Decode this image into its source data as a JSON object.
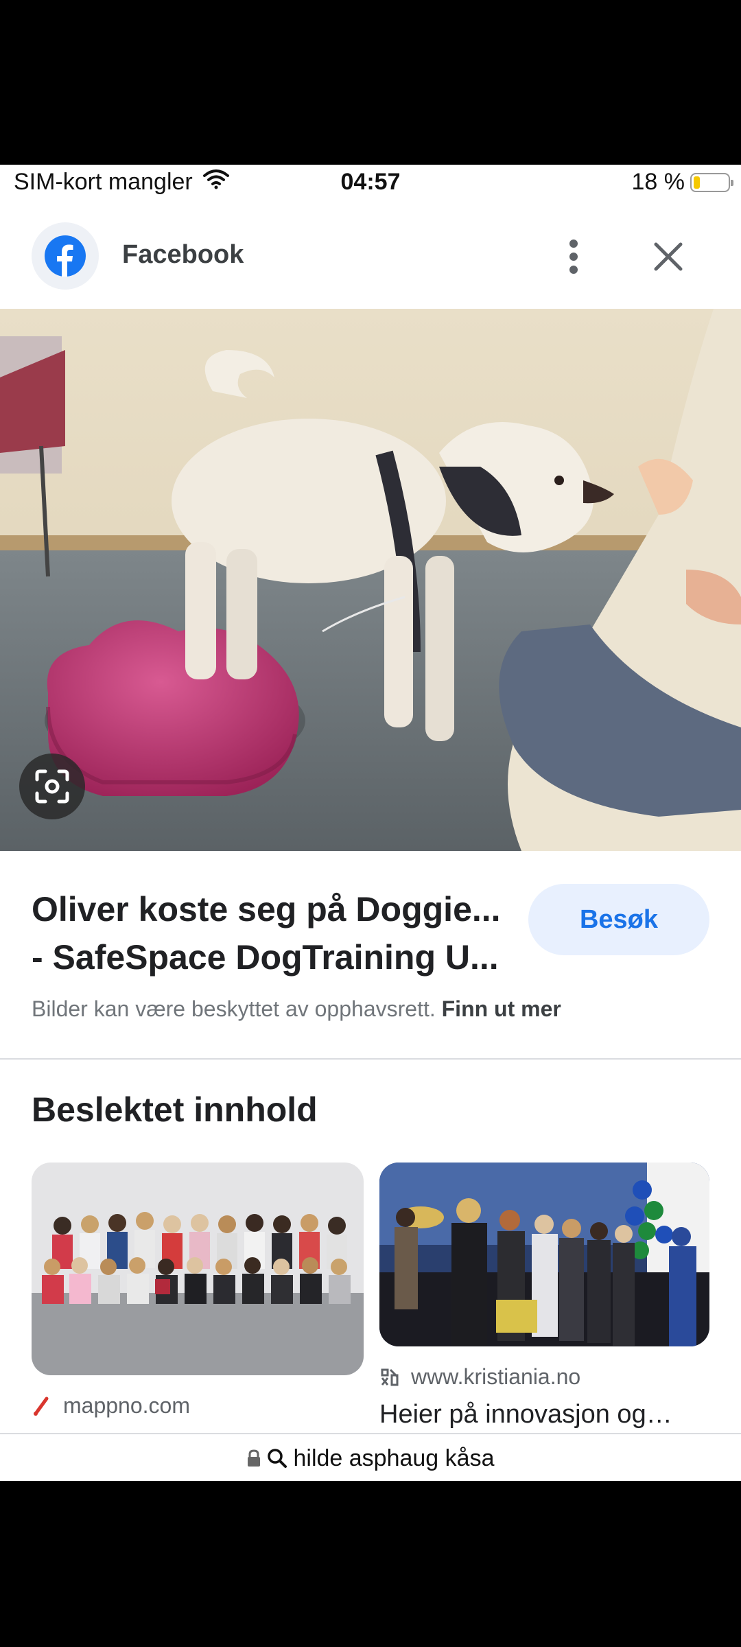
{
  "status_bar": {
    "carrier": "SIM-kort mangler",
    "time": "04:57",
    "battery_percent": "18 %",
    "battery_level": 0.18,
    "icons": [
      "wifi-icon",
      "battery-icon"
    ]
  },
  "header": {
    "app_icon": "facebook-icon",
    "title": "Facebook"
  },
  "result": {
    "title_line1": "Oliver koste seg på Doggie...",
    "title_line2": "- SafeSpace DogTraining U...",
    "visit_label": "Besøk",
    "copyright_text": "Bilder kan være beskyttet av opphavsrett.",
    "copyright_link": "Finn ut mer"
  },
  "related": {
    "heading": "Beslektet innhold",
    "items": [
      {
        "source": "mappno.com",
        "title": ""
      },
      {
        "source": "www.kristiania.no",
        "title": "Heier på innovasjon og…"
      }
    ]
  },
  "url_bar": {
    "query": "hilde asphaug kåsa"
  },
  "colors": {
    "accent": "#1a73e8",
    "visit_bg": "#e8f0fe",
    "facebook_blue": "#1877f2"
  }
}
